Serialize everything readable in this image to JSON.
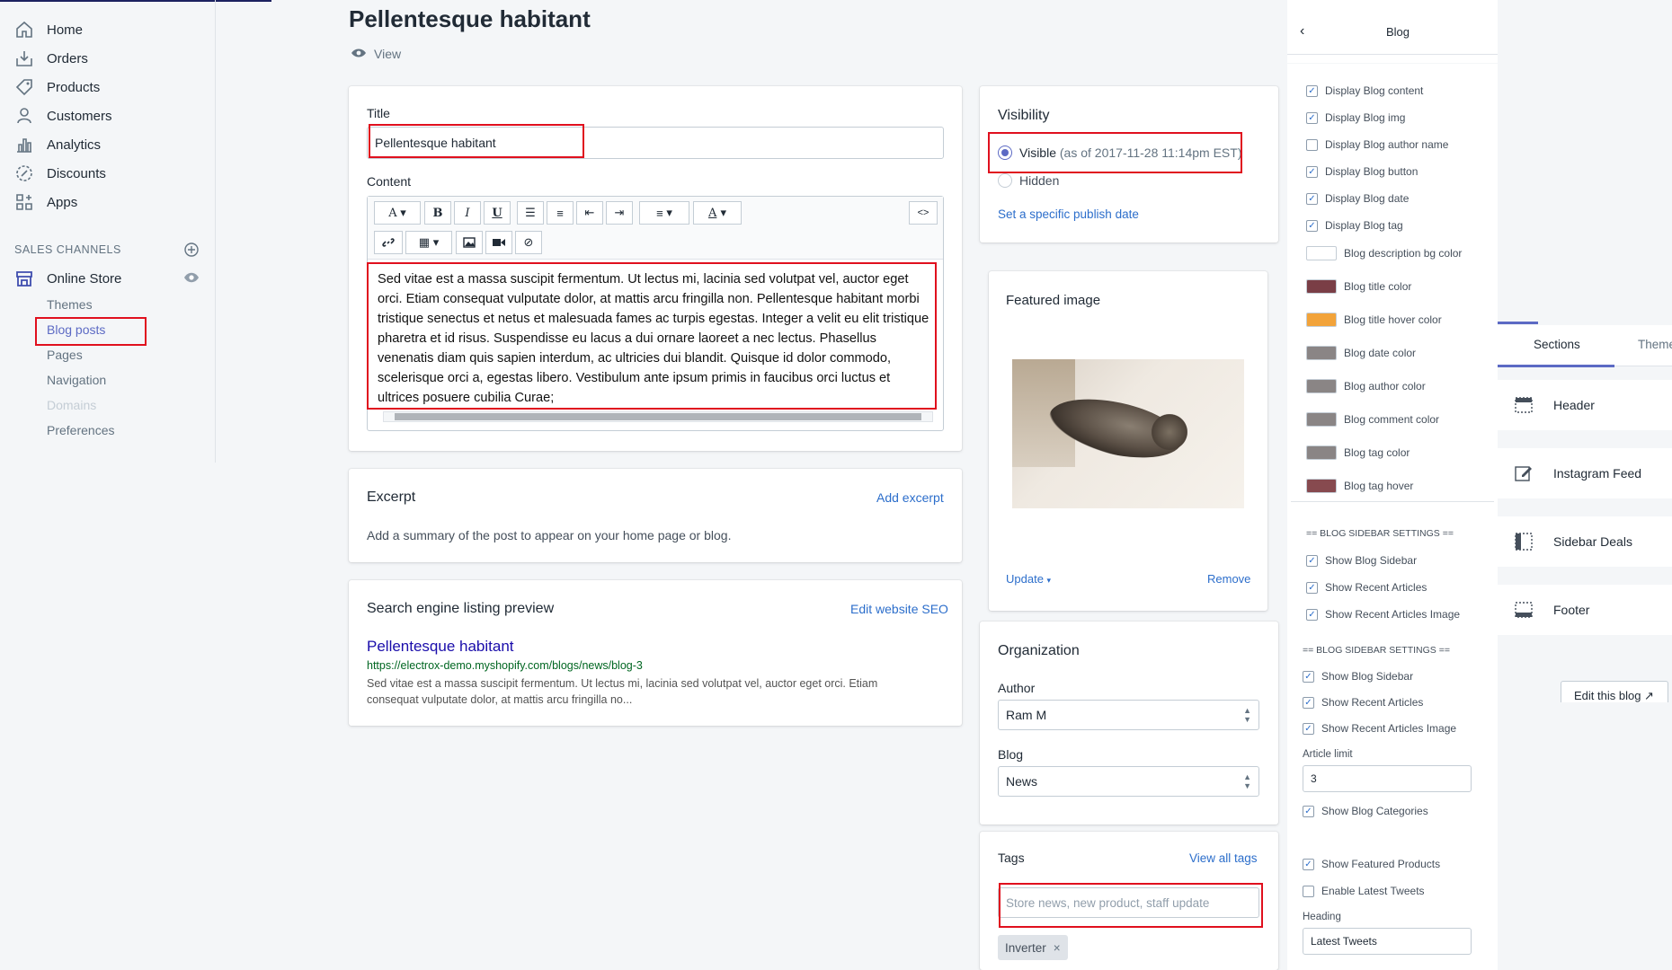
{
  "sidebar": {
    "nav": [
      {
        "label": "Home",
        "icon": "home-icon"
      },
      {
        "label": "Orders",
        "icon": "orders-icon"
      },
      {
        "label": "Products",
        "icon": "tag-icon"
      },
      {
        "label": "Customers",
        "icon": "person-icon"
      },
      {
        "label": "Analytics",
        "icon": "bar-chart-icon"
      },
      {
        "label": "Discounts",
        "icon": "discount-icon"
      },
      {
        "label": "Apps",
        "icon": "apps-icon"
      }
    ],
    "sales_channels_label": "SALES CHANNELS",
    "online_store": "Online Store",
    "sub_items": [
      "Themes",
      "Blog posts",
      "Pages",
      "Navigation",
      "Domains",
      "Preferences"
    ]
  },
  "page": {
    "title": "Pellentesque habitant",
    "view_label": "View"
  },
  "editor": {
    "title_label": "Title",
    "title_value": "Pellentesque habitant",
    "content_label": "Content",
    "content_text": "Sed vitae est a massa suscipit fermentum. Ut lectus mi, lacinia sed volutpat vel, auctor eget orci. Etiam consequat vulputate dolor, at mattis arcu fringilla non. Pellentesque habitant morbi tristique senectus et netus et malesuada fames ac turpis egestas. Integer a velit eu elit tristique pharetra et id risus. Suspendisse eu lacus a dui ornare laoreet a nec lectus. Phasellus venenatis diam quis sapien interdum, ac ultricies dui blandit. Quisque id dolor commodo, scelerisque orci a, egestas libero. Vestibulum ante ipsum primis in faucibus orci luctus et ultrices posuere cubilia Curae;",
    "toolbar": {
      "font": "A",
      "bold": "B",
      "italic": "I",
      "underline": "U",
      "color": "A",
      "html": "<>"
    }
  },
  "excerpt": {
    "title": "Excerpt",
    "action": "Add excerpt",
    "description": "Add a summary of the post to appear on your home page or blog."
  },
  "seo": {
    "title": "Search engine listing preview",
    "action": "Edit website SEO",
    "preview_title": "Pellentesque habitant",
    "preview_url": "https://electrox-demo.myshopify.com/blogs/news/blog-3",
    "preview_desc": "Sed vitae est a massa suscipit fermentum. Ut lectus mi, lacinia sed volutpat vel, auctor eget orci. Etiam consequat vulputate dolor, at mattis arcu fringilla no..."
  },
  "visibility": {
    "title": "Visibility",
    "visible_label": "Visible",
    "visible_note": "(as of 2017-11-28 11:14pm EST)",
    "hidden_label": "Hidden",
    "publish_link": "Set a specific publish date"
  },
  "featured": {
    "title": "Featured image",
    "update": "Update",
    "remove": "Remove"
  },
  "organization": {
    "title": "Organization",
    "author_label": "Author",
    "author_value": "Ram M",
    "blog_label": "Blog",
    "blog_value": "News",
    "tags_label": "Tags",
    "tags_link": "View all tags",
    "tags_placeholder": "Store news, new product, staff update",
    "tag_chip": "Inverter"
  },
  "blog_panel": {
    "title": "Blog",
    "items": [
      {
        "label": "Display Blog content",
        "type": "checkbox",
        "checked": true
      },
      {
        "label": "Display Blog img",
        "type": "checkbox",
        "checked": true
      },
      {
        "label": "Display Blog author name",
        "type": "checkbox",
        "checked": false
      },
      {
        "label": "Display Blog button",
        "type": "checkbox",
        "checked": true
      },
      {
        "label": "Display Blog date",
        "type": "checkbox",
        "checked": true
      },
      {
        "label": "Display Blog tag",
        "type": "checkbox",
        "checked": true
      },
      {
        "label": "Blog description bg color",
        "type": "color",
        "color": "#ffffff"
      },
      {
        "label": "Blog title color",
        "type": "color",
        "color": "#7a3e46"
      },
      {
        "label": "Blog title hover color",
        "type": "color",
        "color": "#f2a33a"
      },
      {
        "label": "Blog date color",
        "type": "color",
        "color": "#8a8585"
      },
      {
        "label": "Blog author color",
        "type": "color",
        "color": "#8a8585"
      },
      {
        "label": "Blog comment color",
        "type": "color",
        "color": "#8a8585"
      },
      {
        "label": "Blog tag color",
        "type": "color",
        "color": "#8a8585"
      },
      {
        "label": "Blog tag hover",
        "type": "color",
        "color": "#874a4f"
      }
    ],
    "sidebar_heading_1": "== BLOG SIDEBAR SETTINGS ==",
    "sidebar_items_1": [
      "Show Blog Sidebar",
      "Show Recent Articles",
      "Show Recent Articles Image"
    ],
    "sidebar_heading_2": "== BLOG SIDEBAR SETTINGS ==",
    "sidebar_items_2": [
      "Show Blog Sidebar",
      "Show Recent Articles",
      "Show Recent Articles Image"
    ],
    "article_limit_label": "Article limit",
    "article_limit_value": "3",
    "show_categories": "Show Blog Categories",
    "show_featured": "Show Featured Products",
    "enable_tweets": "Enable Latest Tweets",
    "heading_label": "Heading",
    "heading_value": "Latest Tweets"
  },
  "sections_panel": {
    "tabs": [
      "Sections",
      "Theme"
    ],
    "rows": [
      "Header",
      "Instagram Feed",
      "Sidebar Deals",
      "Footer"
    ],
    "edit_link": "Edit this blog"
  }
}
